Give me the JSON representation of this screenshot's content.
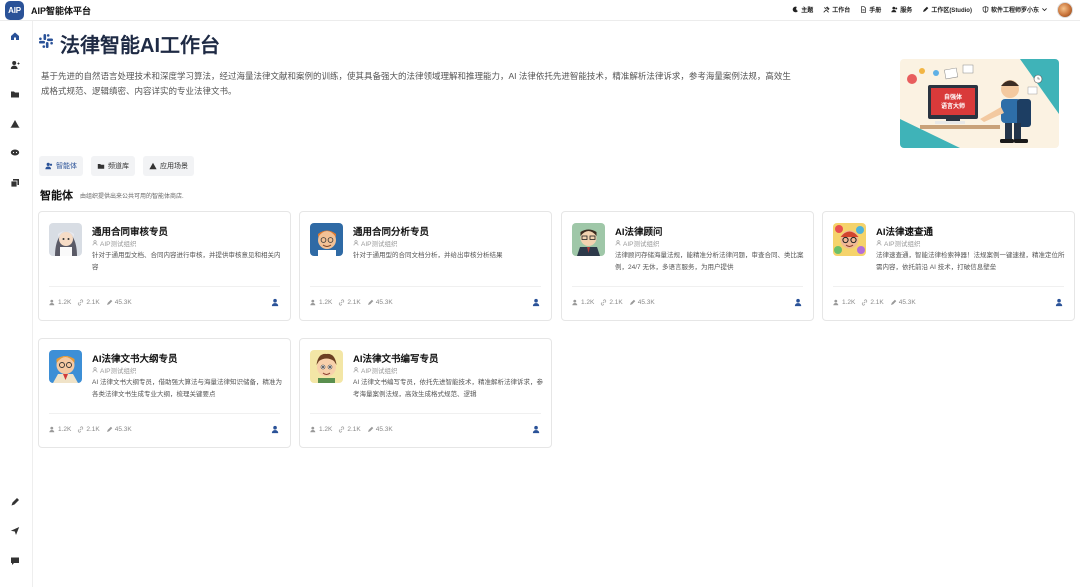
{
  "app": {
    "logo_text": "AIP",
    "title": "AIP智能体平台"
  },
  "topnav": [
    {
      "label": "主题",
      "icon": "moon-icon"
    },
    {
      "label": "工作台",
      "icon": "tools-icon"
    },
    {
      "label": "手册",
      "icon": "document-icon"
    },
    {
      "label": "服务",
      "icon": "users-icon"
    },
    {
      "label": "工作区(Studio)",
      "icon": "pen-icon"
    },
    {
      "label": "软件工程师罗小东",
      "icon": "shield-icon"
    }
  ],
  "page": {
    "title": "法律智能AI工作台",
    "description": "基于先进的自然语言处理技术和深度学习算法，经过海量法律文献和案例的训练，使其具备强大的法律领域理解和推理能力，AI 法律依托先进智能技术，精准解析法律诉求，参考海量案例法规，高效生成格式规范、逻辑缜密、内容详实的专业法律文书。",
    "hero_caption": "自强体\n语言大师"
  },
  "tabs": [
    {
      "label": "智能体",
      "icon": "users-icon",
      "active": true
    },
    {
      "label": "频道库",
      "icon": "folder-icon",
      "active": false
    },
    {
      "label": "应用场景",
      "icon": "warning-icon",
      "active": false
    }
  ],
  "section": {
    "title": "智能体",
    "subtitle": "由组织提供出来公共可用的智能体商店."
  },
  "cards": [
    {
      "name": "通用合同审核专员",
      "org": "AIP测试组织",
      "desc": "针对于通用型文档、合同内容进行审核，并提供审核意见和相关内容",
      "stats": [
        "1.2K",
        "2.1K",
        "45.3K"
      ],
      "avatar": "girl"
    },
    {
      "name": "通用合同分析专员",
      "org": "AIP测试组织",
      "desc": "针对于通用型的合同文档分析，并给出审核分析结果",
      "stats": [
        "1.2K",
        "2.1K",
        "45.3K"
      ],
      "avatar": "boy-glasses"
    },
    {
      "name": "AI法律顾问",
      "org": "AIP测试组织",
      "desc": "法律顾问存储海量法规，能精准分析法律问题，审查合同、类比案例，24/7 无休，多语言服务，为用户提供",
      "stats": [
        "1.2K",
        "2.1K",
        "45.3K"
      ],
      "avatar": "man-glasses"
    },
    {
      "name": "AI法律速查通",
      "org": "AIP测试组织",
      "desc": "法律速查通，智能法律检索神器！法规案例一键速搜，精准定位所需内容，依托前沿 AI 技术，打破信息壁垒",
      "stats": [
        "1.2K",
        "2.1K",
        "45.3K"
      ],
      "avatar": "colorful"
    },
    {
      "name": "AI法律文书大纲专员",
      "org": "AIP测试组织",
      "desc": "AI 法律文书大纲专员，借助强大算法与海量法律知识储备，精准为各类法律文书生成专业大纲，梳理关键要点",
      "stats": [
        "1.2K",
        "2.1K",
        "45.3K"
      ],
      "avatar": "boy-blue"
    },
    {
      "name": "AI法律文书编写专员",
      "org": "AIP测试组织",
      "desc": "AI 法律文书编写专员，依托先进智能技术，精准解析法律诉求，参考海量案例法规，高效生成格式规范、逻辑",
      "stats": [
        "1.2K",
        "2.1K",
        "45.3K"
      ],
      "avatar": "boy-cartoon"
    }
  ],
  "sidebar": {
    "items": [
      "home-icon",
      "user-icon",
      "folder-icon",
      "warning-icon",
      "chat-icon",
      "copy-icon"
    ],
    "bottom_items": [
      "pen-icon",
      "send-icon",
      "message-icon"
    ]
  },
  "colors": {
    "accent": "#2a5298",
    "title": "#1e2a44",
    "border": "#e6e6e6"
  }
}
